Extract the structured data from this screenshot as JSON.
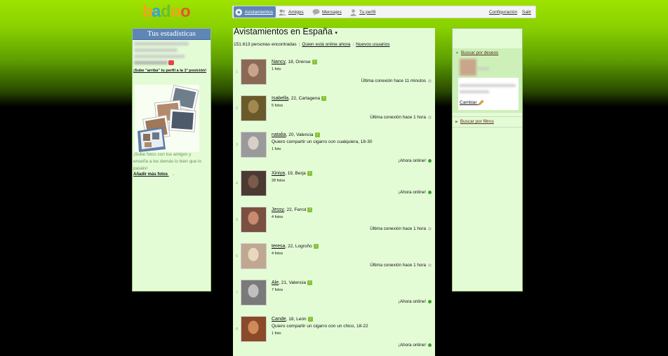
{
  "logo": {
    "text": "badoo"
  },
  "nav": {
    "tabs": [
      {
        "label": "Avistamientos",
        "icon": "radar-icon",
        "active": true
      },
      {
        "label": "Amigos",
        "icon": "friends-icon"
      },
      {
        "label": "Mensajes",
        "icon": "speech-bubble-icon"
      },
      {
        "label": "Tu perfil",
        "icon": "user-icon"
      }
    ],
    "settings": "Configuración",
    "logout": "Salir"
  },
  "left": {
    "title": "Tus estadísticas",
    "promo_link": "¡Sube \"arriba\" tu perfil a la 1ª posición!",
    "photos_text": "¡Sube fotos con tus amigos y enseña a los demás lo bien que lo pasáis!",
    "add_photos": "Añadir más fotos",
    "add_photos_arrow": "→"
  },
  "main": {
    "title": "Avistamientos en España",
    "title_arrow": "▾",
    "count": "151.613 personas encontradas",
    "link_online": "Quien está online ahora",
    "link_new": "Nuevos usuarios",
    "users": [
      {
        "num": "1",
        "name": "Nancy",
        "details": ", 18, Orense",
        "desc": "",
        "photos": "1 foto",
        "status": "Última conexión hace 11 minutos",
        "online": false
      },
      {
        "num": "2",
        "name": "Isabella",
        "details": ", 22, Cartagena",
        "desc": "",
        "photos": "5 fotos",
        "status": "Última conexión hace 1 hora",
        "online": false
      },
      {
        "num": "3",
        "name": "natalia",
        "details": ", 20, Valencia",
        "desc": "Quiero compartir un cigarro con cualquiera, 18-30",
        "photos": "1 foto",
        "status": "¡Ahora online!",
        "online": true
      },
      {
        "num": "4",
        "name": "Xiniya",
        "details": ", 19, Berja",
        "desc": "",
        "photos": "28 fotos",
        "status": "¡Ahora online!",
        "online": true
      },
      {
        "num": "5",
        "name": "Jessy",
        "details": ", 22, Ferrol",
        "desc": "",
        "photos": "4 fotos",
        "status": "Última conexión hace 1 hora",
        "online": false
      },
      {
        "num": "6",
        "name": "teresa",
        "details": ", 22, Logroño",
        "desc": "",
        "photos": "4 fotos",
        "status": "Última conexión hace 1 hora",
        "online": false
      },
      {
        "num": "7",
        "name": "Ale",
        "details": ", 21, Valencia",
        "desc": "",
        "photos": "7 fotos",
        "status": "¡Ahora online!",
        "online": true
      },
      {
        "num": "8",
        "name": "Cande",
        "details": ", 18, León",
        "desc": "Quiero compartir un cigarro con un chico, 18-22",
        "photos": "1 foto",
        "status": "¡Ahora online!",
        "online": true
      }
    ]
  },
  "right": {
    "search_wishes": "Buscar por deseos",
    "change": "Cambiar",
    "search_filters": "Buscar por filtros"
  },
  "colors": {
    "accent_blue": "#5f86b6",
    "panel_green": "#e4fcd6",
    "online": "#3aa52a",
    "offline": "#c9c9c9"
  }
}
